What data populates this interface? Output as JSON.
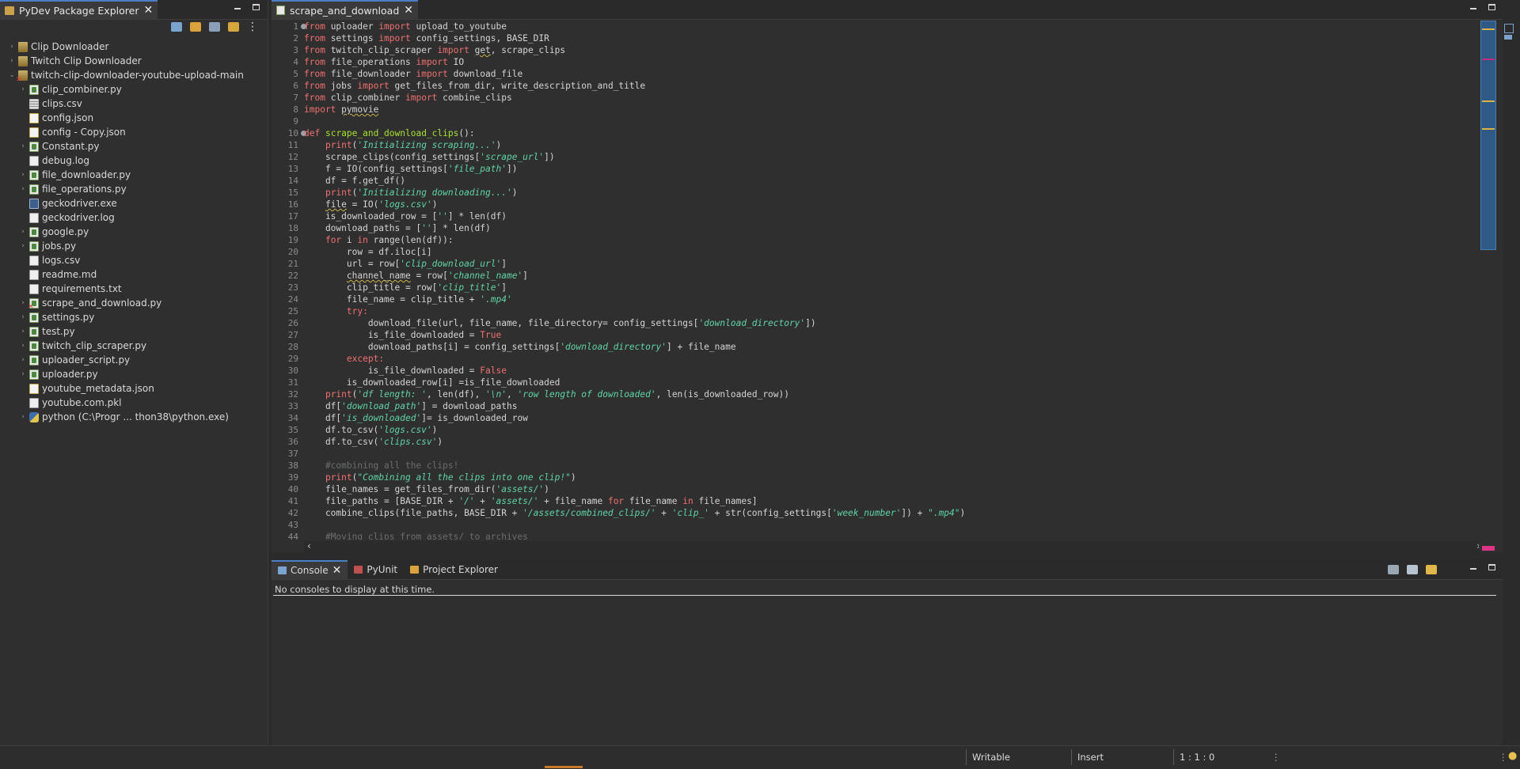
{
  "explorer": {
    "tab_label": "PyDev Package Explorer",
    "items": [
      {
        "label": "Clip Downloader",
        "type": "project"
      },
      {
        "label": "Twitch Clip Downloader",
        "type": "project"
      },
      {
        "label": "twitch-clip-downloader-youtube-upload-main",
        "type": "project"
      },
      {
        "label": "clip_combiner.py",
        "type": "py"
      },
      {
        "label": "clips.csv",
        "type": "csv"
      },
      {
        "label": "config.json",
        "type": "json"
      },
      {
        "label": "config - Copy.json",
        "type": "json"
      },
      {
        "label": "Constant.py",
        "type": "py"
      },
      {
        "label": "debug.log",
        "type": "txt"
      },
      {
        "label": "file_downloader.py",
        "type": "py"
      },
      {
        "label": "file_operations.py",
        "type": "py"
      },
      {
        "label": "geckodriver.exe",
        "type": "exe"
      },
      {
        "label": "geckodriver.log",
        "type": "txt"
      },
      {
        "label": "google.py",
        "type": "py"
      },
      {
        "label": "jobs.py",
        "type": "py"
      },
      {
        "label": "logs.csv",
        "type": "txt"
      },
      {
        "label": "readme.md",
        "type": "txt"
      },
      {
        "label": "requirements.txt",
        "type": "txt"
      },
      {
        "label": "scrape_and_download.py",
        "type": "py"
      },
      {
        "label": "settings.py",
        "type": "py"
      },
      {
        "label": "test.py",
        "type": "py"
      },
      {
        "label": "twitch_clip_scraper.py",
        "type": "py"
      },
      {
        "label": "uploader_script.py",
        "type": "py"
      },
      {
        "label": "uploader.py",
        "type": "py"
      },
      {
        "label": "youtube_metadata.json",
        "type": "json"
      },
      {
        "label": "youtube.com.pkl",
        "type": "txt"
      },
      {
        "label": "python  (C:\\Progr ... thon38\\python.exe)",
        "type": "lib"
      }
    ]
  },
  "editor": {
    "tab_label": "scrape_and_download",
    "lines": [
      [
        [
          "from",
          "kw"
        ],
        [
          " uploader ",
          ""
        ],
        [
          "import",
          "kw"
        ],
        [
          " upload_to_youtube",
          ""
        ]
      ],
      [
        [
          "from",
          "kw"
        ],
        [
          " settings ",
          ""
        ],
        [
          "import",
          "kw"
        ],
        [
          " config_settings, BASE_DIR",
          ""
        ]
      ],
      [
        [
          "from",
          "kw"
        ],
        [
          " twitch_clip_scraper ",
          ""
        ],
        [
          "import",
          "kw"
        ],
        [
          " ",
          ""
        ],
        [
          "get",
          "squig"
        ],
        [
          ", scrape_clips",
          ""
        ]
      ],
      [
        [
          "from",
          "kw"
        ],
        [
          " file_operations ",
          ""
        ],
        [
          "import",
          "kw"
        ],
        [
          " IO",
          ""
        ]
      ],
      [
        [
          "from",
          "kw"
        ],
        [
          " file_downloader ",
          ""
        ],
        [
          "import",
          "kw"
        ],
        [
          " download_file",
          ""
        ]
      ],
      [
        [
          "from",
          "kw"
        ],
        [
          " jobs ",
          ""
        ],
        [
          "import",
          "kw"
        ],
        [
          " get_files_from_dir, write_description_and_title",
          ""
        ]
      ],
      [
        [
          "from",
          "kw"
        ],
        [
          " clip_combiner ",
          ""
        ],
        [
          "import",
          "kw"
        ],
        [
          " combine_clips",
          ""
        ]
      ],
      [
        [
          "import",
          "kw"
        ],
        [
          " ",
          ""
        ],
        [
          "pymovie",
          "squig"
        ]
      ],
      [],
      [
        [
          "def",
          "kw"
        ],
        [
          " ",
          ""
        ],
        [
          "scrape_and_download_clips",
          "fn"
        ],
        [
          "():",
          ""
        ]
      ],
      [
        [
          "    ",
          ""
        ],
        [
          "print",
          "kw"
        ],
        [
          "(",
          ""
        ],
        [
          "'Initializing scraping...'",
          "str"
        ],
        [
          ")",
          ""
        ]
      ],
      [
        [
          "    scrape_clips(config_settings[",
          ""
        ],
        [
          "'scrape_url'",
          "str"
        ],
        [
          "])",
          ""
        ]
      ],
      [
        [
          "    f = IO(config_settings[",
          ""
        ],
        [
          "'file_path'",
          "str"
        ],
        [
          "])",
          ""
        ]
      ],
      [
        [
          "    df = f.get_df()",
          ""
        ]
      ],
      [
        [
          "    ",
          ""
        ],
        [
          "print",
          "kw"
        ],
        [
          "(",
          ""
        ],
        [
          "'Initializing downloading...'",
          "str"
        ],
        [
          ")",
          ""
        ]
      ],
      [
        [
          "    ",
          ""
        ],
        [
          "file",
          "squig"
        ],
        [
          " = IO(",
          ""
        ],
        [
          "'logs.csv'",
          "str"
        ],
        [
          ")",
          ""
        ]
      ],
      [
        [
          "    is_downloaded_row = [",
          ""
        ],
        [
          "''",
          "str"
        ],
        [
          "] * len(df)",
          ""
        ]
      ],
      [
        [
          "    download_paths = [",
          ""
        ],
        [
          "''",
          "str"
        ],
        [
          "] * len(df)",
          ""
        ]
      ],
      [
        [
          "    ",
          ""
        ],
        [
          "for",
          "kw"
        ],
        [
          " i ",
          ""
        ],
        [
          "in",
          "kw"
        ],
        [
          " range(len(df)):",
          ""
        ]
      ],
      [
        [
          "        row = df.iloc[i]",
          ""
        ]
      ],
      [
        [
          "        url = row[",
          ""
        ],
        [
          "'clip_download_url'",
          "str"
        ],
        [
          "]",
          ""
        ]
      ],
      [
        [
          "        ",
          ""
        ],
        [
          "channel_name",
          "squig"
        ],
        [
          " = row[",
          ""
        ],
        [
          "'channel_name'",
          "str"
        ],
        [
          "]",
          ""
        ]
      ],
      [
        [
          "        clip_title = row[",
          ""
        ],
        [
          "'clip_title'",
          "str"
        ],
        [
          "]",
          ""
        ]
      ],
      [
        [
          "        file_name = clip_title + ",
          ""
        ],
        [
          "'.mp4'",
          "str"
        ]
      ],
      [
        [
          "        ",
          ""
        ],
        [
          "try",
          "kw"
        ],
        [
          ":",
          "kw"
        ]
      ],
      [
        [
          "            download_file(url, file_name, file_directory= config_settings[",
          ""
        ],
        [
          "'download_directory'",
          "str"
        ],
        [
          "])",
          ""
        ]
      ],
      [
        [
          "            is_file_downloaded = ",
          ""
        ],
        [
          "True",
          "kw"
        ]
      ],
      [
        [
          "            download_paths[i] = config_settings[",
          ""
        ],
        [
          "'download_directory'",
          "str"
        ],
        [
          "] + file_name",
          ""
        ]
      ],
      [
        [
          "        ",
          ""
        ],
        [
          "except",
          "kw"
        ],
        [
          ":",
          "kw"
        ]
      ],
      [
        [
          "            is_file_downloaded = ",
          ""
        ],
        [
          "False",
          "kw"
        ]
      ],
      [
        [
          "        is_downloaded_row[i] =is_file_downloaded",
          ""
        ]
      ],
      [
        [
          "    ",
          ""
        ],
        [
          "print",
          "kw"
        ],
        [
          "(",
          ""
        ],
        [
          "'df length: '",
          "str"
        ],
        [
          ", len(df), ",
          ""
        ],
        [
          "'\\n'",
          "str"
        ],
        [
          ", ",
          ""
        ],
        [
          "'row length of downloaded'",
          "str"
        ],
        [
          ", len(is_downloaded_row))",
          ""
        ]
      ],
      [
        [
          "    df[",
          ""
        ],
        [
          "'download_path'",
          "str"
        ],
        [
          "] = download_paths",
          ""
        ]
      ],
      [
        [
          "    df[",
          ""
        ],
        [
          "'is_downloaded'",
          "str"
        ],
        [
          "]= is_downloaded_row",
          ""
        ]
      ],
      [
        [
          "    df.to_csv(",
          ""
        ],
        [
          "'logs.csv'",
          "str"
        ],
        [
          ")",
          ""
        ]
      ],
      [
        [
          "    df.to_csv(",
          ""
        ],
        [
          "'clips.csv'",
          "str"
        ],
        [
          ")",
          ""
        ]
      ],
      [],
      [
        [
          "    #combining all the clips!",
          "cm"
        ]
      ],
      [
        [
          "    ",
          ""
        ],
        [
          "print",
          "kw"
        ],
        [
          "(",
          ""
        ],
        [
          "\"Combining all the clips into one clip!\"",
          "str"
        ],
        [
          ")",
          ""
        ]
      ],
      [
        [
          "    file_names = get_files_from_dir(",
          ""
        ],
        [
          "'assets/'",
          "str"
        ],
        [
          ")",
          ""
        ]
      ],
      [
        [
          "    file_paths = [BASE_DIR + ",
          ""
        ],
        [
          "'/'",
          "str"
        ],
        [
          " + ",
          ""
        ],
        [
          "'assets/'",
          "str"
        ],
        [
          " + file_name ",
          ""
        ],
        [
          "for",
          "kw"
        ],
        [
          " file_name ",
          ""
        ],
        [
          "in",
          "kw"
        ],
        [
          " file_names]",
          ""
        ]
      ],
      [
        [
          "    combine_clips(file_paths, BASE_DIR + ",
          ""
        ],
        [
          "'/assets/combined_clips/'",
          "str"
        ],
        [
          " + ",
          ""
        ],
        [
          "'clip_'",
          "str"
        ],
        [
          " + str(config_settings[",
          ""
        ],
        [
          "'week_number'",
          "str"
        ],
        [
          "]) + ",
          ""
        ],
        [
          "\".mp4\"",
          "str"
        ],
        [
          ")",
          ""
        ]
      ],
      [],
      [
        [
          "    #Moving clips from assets/ to archives",
          "cm"
        ]
      ]
    ]
  },
  "console": {
    "tabs": [
      "Console",
      "PyUnit",
      "Project Explorer"
    ],
    "message": "No consoles to display at this time."
  },
  "status": {
    "writable": "Writable",
    "insert": "Insert",
    "position": "1 : 1 : 0"
  },
  "colors": {
    "keyword": "#f07070",
    "function": "#a6e22e",
    "string": "#5fd4a6",
    "comment": "#6d6d6d",
    "accent": "#4a80c3"
  }
}
